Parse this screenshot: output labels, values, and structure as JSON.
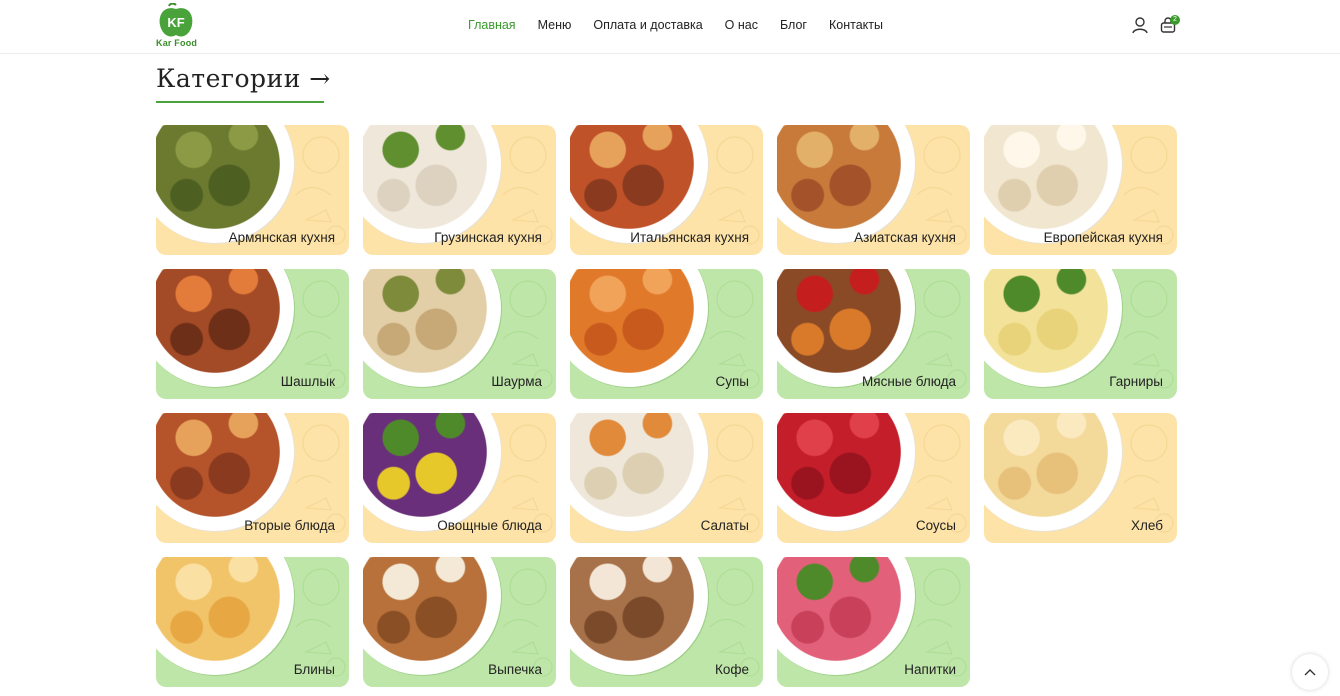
{
  "header": {
    "logo_text": "Kar Food",
    "logo_mark": "KF",
    "nav": [
      {
        "label": "Главная",
        "active": true
      },
      {
        "label": "Меню",
        "active": false
      },
      {
        "label": "Оплата и доставка",
        "active": false
      },
      {
        "label": "О нас",
        "active": false
      },
      {
        "label": "Блог",
        "active": false
      },
      {
        "label": "Контакты",
        "active": false
      }
    ],
    "user_icon": "user-icon",
    "cart_icon": "cart-icon",
    "cart_count": "2"
  },
  "section": {
    "title": "Категории →"
  },
  "colors": {
    "accent": "#3a9b2c",
    "card_yellow": "#fde3a7",
    "card_green": "#bfe6a9"
  },
  "categories": [
    {
      "label": "Армянская кухня",
      "theme": "yellow",
      "food": [
        "#6b7a2f",
        "#4e5f22",
        "#8c9a45"
      ]
    },
    {
      "label": "Грузинская кухня",
      "theme": "yellow",
      "food": [
        "#efe7da",
        "#ddd2c0",
        "#5f8f2f"
      ]
    },
    {
      "label": "Итальянская кухня",
      "theme": "yellow",
      "food": [
        "#c0522a",
        "#8a3a1e",
        "#e6a25a"
      ]
    },
    {
      "label": "Азиатская кухня",
      "theme": "yellow",
      "food": [
        "#c77a3a",
        "#a4522a",
        "#e3b06a"
      ]
    },
    {
      "label": "Европейская кухня",
      "theme": "yellow",
      "food": [
        "#f1e6cf",
        "#e0cfae",
        "#fff7ea"
      ]
    },
    {
      "label": "Шашлык",
      "theme": "green",
      "food": [
        "#a34a26",
        "#6e2f18",
        "#e37b3a"
      ]
    },
    {
      "label": "Шаурма",
      "theme": "green",
      "food": [
        "#e2cfa8",
        "#c7a877",
        "#7d8b3a"
      ]
    },
    {
      "label": "Супы",
      "theme": "green",
      "food": [
        "#e07a2a",
        "#c85a1e",
        "#f2a35a"
      ]
    },
    {
      "label": "Мясные блюда",
      "theme": "green",
      "food": [
        "#8a4a26",
        "#d87a2a",
        "#c41e1e"
      ]
    },
    {
      "label": "Гарниры",
      "theme": "green",
      "food": [
        "#f3e39a",
        "#e8d27a",
        "#4f8a2a"
      ]
    },
    {
      "label": "Вторые блюда",
      "theme": "yellow",
      "food": [
        "#b5532a",
        "#8a3a1e",
        "#e6a25a"
      ]
    },
    {
      "label": "Овощные блюда",
      "theme": "yellow",
      "food": [
        "#6a2f7a",
        "#e6c82a",
        "#4f8a2a"
      ]
    },
    {
      "label": "Салаты",
      "theme": "yellow",
      "food": [
        "#efe7da",
        "#dccfb2",
        "#e08a3a"
      ]
    },
    {
      "label": "Соусы",
      "theme": "yellow",
      "food": [
        "#c41e2a",
        "#9a1420",
        "#e0404a"
      ]
    },
    {
      "label": "Хлеб",
      "theme": "yellow",
      "food": [
        "#f3d99a",
        "#e7c07a",
        "#fbeac0"
      ]
    },
    {
      "label": "Блины",
      "theme": "green",
      "food": [
        "#f2c46a",
        "#e7a844",
        "#fbe0a4"
      ]
    },
    {
      "label": "Выпечка",
      "theme": "green",
      "food": [
        "#b8713a",
        "#8a4f25",
        "#f3e9d6"
      ]
    },
    {
      "label": "Кофе",
      "theme": "green",
      "food": [
        "#a7724a",
        "#7a4a2a",
        "#f3e6d6"
      ]
    },
    {
      "label": "Напитки",
      "theme": "green",
      "food": [
        "#e2607a",
        "#c8405a",
        "#4f8a2a"
      ]
    }
  ],
  "scroll_top_icon": "chevron-up-icon"
}
